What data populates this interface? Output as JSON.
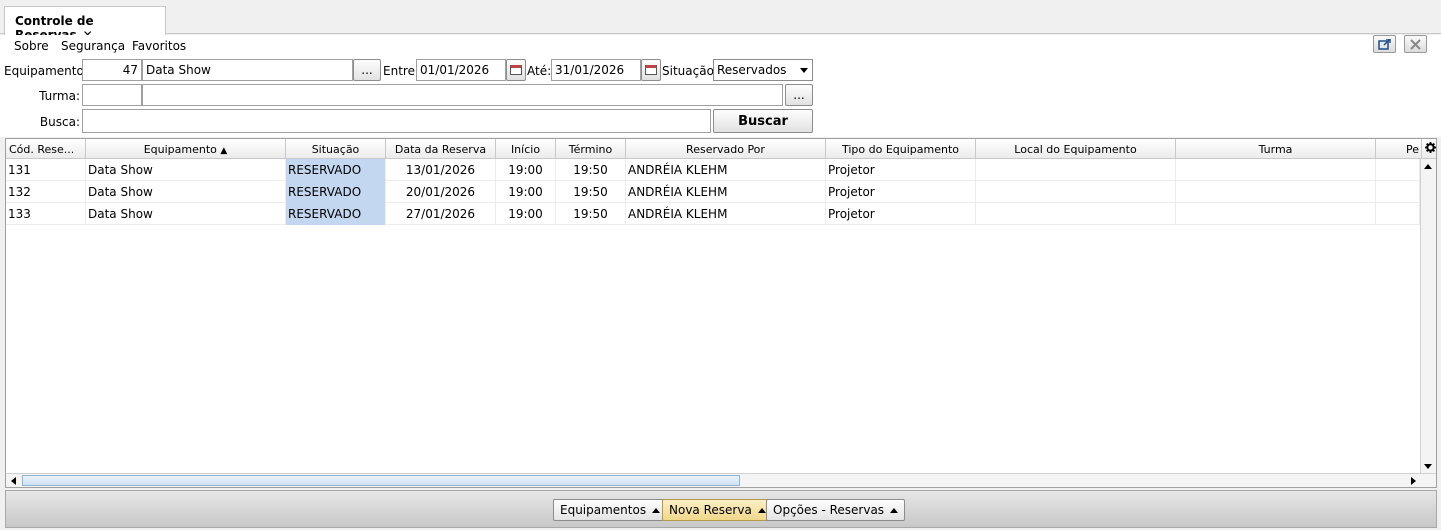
{
  "tab": {
    "title": "Controle de Reservas",
    "close_glyph": "✕"
  },
  "menu": {
    "items": [
      "Sobre",
      "Segurança",
      "Favoritos"
    ]
  },
  "form": {
    "equipamento_label": "Equipamento:",
    "equipamento_code": "47",
    "equipamento_name": "Data Show",
    "lookup_label": "...",
    "entre_label": "Entre:",
    "entre_value": "01/01/2026",
    "ate_label": "Até:",
    "ate_value": "31/01/2026",
    "situacao_label": "Situação:",
    "situacao_value": "Reservados",
    "turma_label": "Turma:",
    "turma_code": "",
    "turma_name": "",
    "busca_label": "Busca:",
    "busca_value": "",
    "buscar_label": "Buscar"
  },
  "grid": {
    "columns": [
      "Cód. Rese...",
      "Equipamento",
      "Situação",
      "Data da Reserva",
      "Início",
      "Término",
      "Reservado Por",
      "Tipo do Equipamento",
      "Local do Equipamento",
      "Turma",
      "Pe"
    ],
    "sort_indicator": "▲",
    "rows": [
      [
        "131",
        "Data Show",
        "RESERVADO",
        "13/01/2026",
        "19:00",
        "19:50",
        "ANDRÉIA KLEHM",
        "Projetor",
        "",
        "",
        ""
      ],
      [
        "132",
        "Data Show",
        "RESERVADO",
        "20/01/2026",
        "19:00",
        "19:50",
        "ANDRÉIA KLEHM",
        "Projetor",
        "",
        "",
        ""
      ],
      [
        "133",
        "Data Show",
        "RESERVADO",
        "27/01/2026",
        "19:00",
        "19:50",
        "ANDRÉIA KLEHM",
        "Projetor",
        "",
        "",
        ""
      ]
    ]
  },
  "footer": {
    "equipamentos_label": "Equipamentos",
    "nova_reserva_label": "Nova Reserva",
    "opcoes_label": "Opções - Reservas"
  },
  "colors": {
    "selection": "#c3d7f0",
    "highlight_button": "#f0d78a"
  }
}
